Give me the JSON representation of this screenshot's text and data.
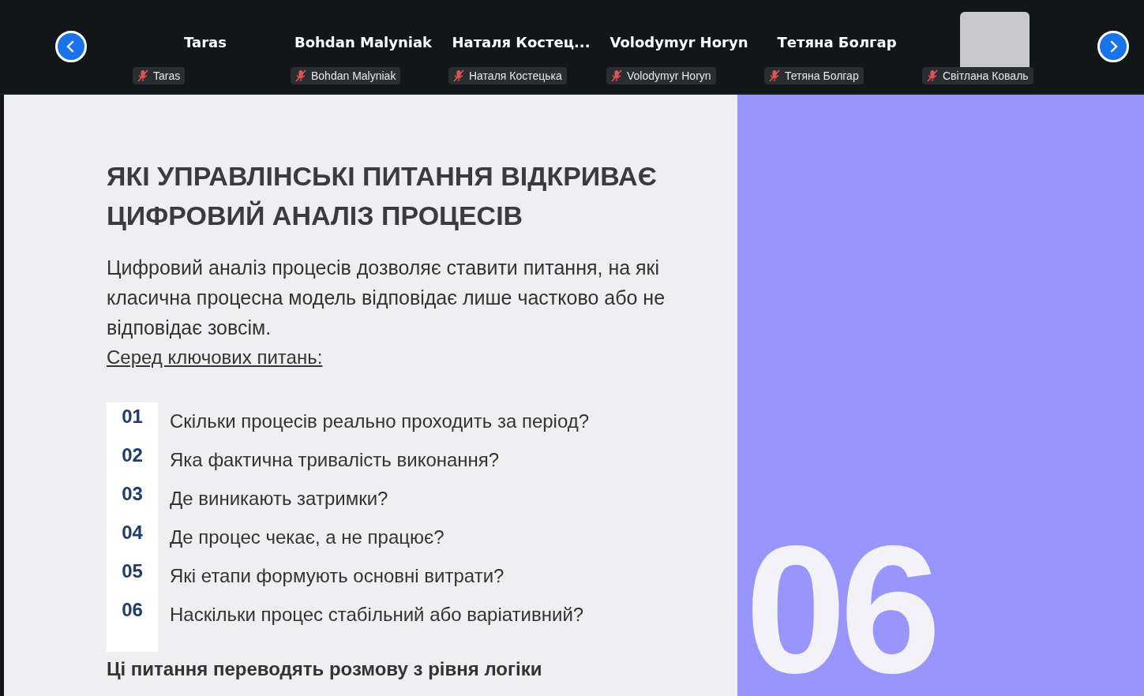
{
  "participants": [
    {
      "kind": "name",
      "display": "Taras",
      "label": "Taras",
      "muted": true
    },
    {
      "kind": "name",
      "display": "Bohdan Malyniak",
      "label": "Bohdan Malyniak",
      "muted": true
    },
    {
      "kind": "name",
      "display": "Наталя  Костец...",
      "label": "Наталя Костецька",
      "muted": true
    },
    {
      "kind": "name",
      "display": "Volodymyr Horyn",
      "label": "Volodymyr Horyn",
      "muted": true
    },
    {
      "kind": "name",
      "display": "Тетяна Болгар",
      "label": "Тетяна Болгар",
      "muted": true
    },
    {
      "kind": "photo",
      "label": "Світлана Коваль",
      "muted": true
    }
  ],
  "slide": {
    "title": "ЯКІ УПРАВЛІНСЬКІ ПИТАННЯ ВІДКРИВАЄ ЦИФРОВИЙ АНАЛІЗ ПРОЦЕСІВ",
    "intro": "Цифровий аналіз процесів дозволяє ставити питання, на які класична процесна модель відповідає лише частково або не відповідає зовсім.",
    "subheading": "Серед ключових питань:",
    "questions": [
      {
        "number": "01",
        "text": "Скільки процесів реально проходить за період?"
      },
      {
        "number": "02",
        "text": "Яка фактична тривалість виконання?"
      },
      {
        "number": "03",
        "text": "Де виникають затримки?"
      },
      {
        "number": "04",
        "text": "Де процес чекає, а не працює?"
      },
      {
        "number": "05",
        "text": "Які етапи формують основні витрати?"
      },
      {
        "number": "06",
        "text": "Наскільки процес стабільний або варіативний?"
      }
    ],
    "conclusion": "Ці питання переводять розмову з рівня логіки",
    "slide_number": "06"
  }
}
